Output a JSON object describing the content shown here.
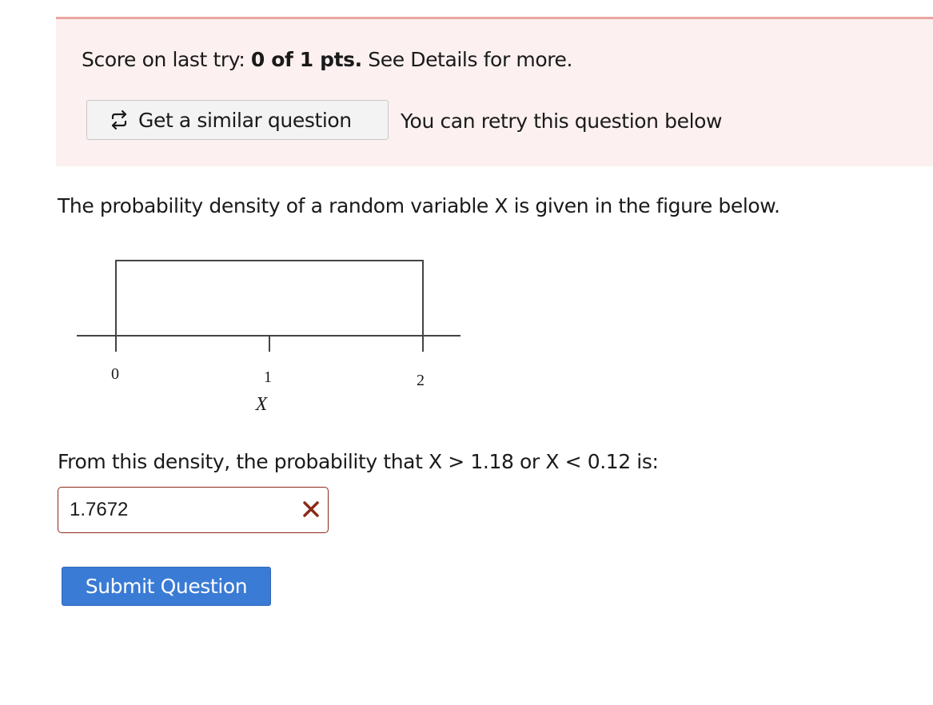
{
  "score": {
    "prefix": "Score on last try: ",
    "value": "0 of 1 pts.",
    "suffix": " See Details for more."
  },
  "similar_button": {
    "icon": "retry-arrows-icon",
    "label": "Get a similar question"
  },
  "retry_text": "You can retry this question below",
  "question_intro": "The probability density of a random variable X is given in the figure below.",
  "figure": {
    "tick_labels": [
      "0",
      "1",
      "2"
    ],
    "axis_label": "X",
    "density_support": [
      0,
      2
    ]
  },
  "prompt": "From this density, the probability that X > 1.18 or X < 0.12 is:",
  "answer": {
    "value": "1.7672",
    "status_icon": "incorrect-x-icon"
  },
  "submit_button": {
    "label": "Submit Question"
  },
  "colors": {
    "banner_bg": "#fcf0f0",
    "banner_border": "#e8a59f",
    "error": "#8b2a1a",
    "submit_bg": "#3a7bd5"
  }
}
